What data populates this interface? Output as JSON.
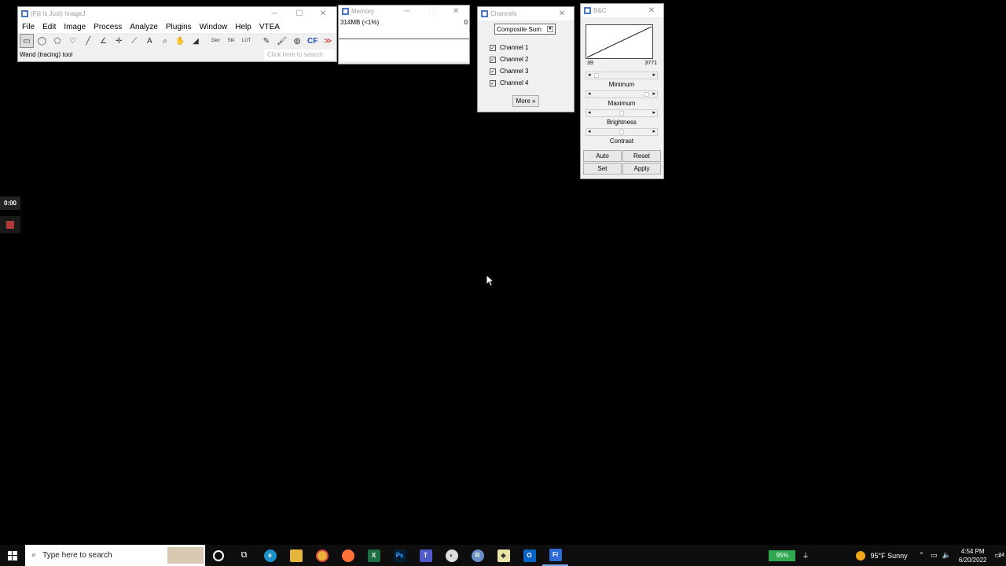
{
  "fiji": {
    "title": "(Fiji Is Just) ImageJ",
    "menu": [
      "File",
      "Edit",
      "Image",
      "Process",
      "Analyze",
      "Plugins",
      "Window",
      "Help",
      "VTEA"
    ],
    "tools": [
      {
        "name": "rectangle-tool-icon",
        "glyph": "▭"
      },
      {
        "name": "oval-tool-icon",
        "glyph": "◯"
      },
      {
        "name": "polygon-tool-icon",
        "glyph": "⬠"
      },
      {
        "name": "freehand-tool-icon",
        "glyph": "♡"
      },
      {
        "name": "line-tool-icon",
        "glyph": "╱"
      },
      {
        "name": "angle-tool-icon",
        "glyph": "∠"
      },
      {
        "name": "point-tool-icon",
        "glyph": "✛"
      },
      {
        "name": "wand-tool-icon",
        "glyph": "⟋"
      },
      {
        "name": "text-tool-icon",
        "glyph": "A"
      },
      {
        "name": "magnifier-tool-icon",
        "glyph": "⌕"
      },
      {
        "name": "hand-tool-icon",
        "glyph": "✋"
      },
      {
        "name": "color-picker-tool-icon",
        "glyph": "◢"
      },
      {
        "name": "dev-tool-icon",
        "glyph": "Dev"
      },
      {
        "name": "stk-tool-icon",
        "glyph": "Stk"
      },
      {
        "name": "lut-tool-icon",
        "glyph": "LUT"
      },
      {
        "name": "pencil-tool-icon",
        "glyph": "✎"
      },
      {
        "name": "brush-tool-icon",
        "glyph": "🖌"
      },
      {
        "name": "flood-fill-tool-icon",
        "glyph": "◍"
      },
      {
        "name": "cf-tool-icon",
        "glyph": "CF"
      },
      {
        "name": "more-tools-icon",
        "glyph": "≫"
      }
    ],
    "status": "Wand (tracing) tool",
    "search_placeholder": "Click here to search"
  },
  "memory": {
    "title": "Memory",
    "usage": "314MB (<1%)",
    "value": "0"
  },
  "channels": {
    "title": "Channels",
    "mode": "Composite Sum",
    "items": [
      "Channel 1",
      "Channel 2",
      "Channel 3",
      "Channel 4"
    ],
    "more": "More »"
  },
  "bc": {
    "title": "B&C",
    "min_value": "39",
    "max_value": "3771",
    "labels": [
      "Minimum",
      "Maximum",
      "Brightness",
      "Contrast"
    ],
    "buttons": [
      "Auto",
      "Reset",
      "Set",
      "Apply"
    ]
  },
  "overlay": {
    "timer": "0:00"
  },
  "taskbar": {
    "search_placeholder": "Type here to search",
    "battery": "95%",
    "weather": "95°F  Sunny",
    "time": "4:54 PM",
    "date": "6/20/2022",
    "notification_count": "24",
    "colors": {
      "excel": "#1d6f42",
      "photoshop": "#001e36",
      "teams": "#5059c9",
      "outlook": "#0a64c8",
      "edge": "#1e90c8",
      "chrome": "#e9b23b",
      "firefox": "#ff7139",
      "fiji": "#2f6bd6"
    }
  }
}
